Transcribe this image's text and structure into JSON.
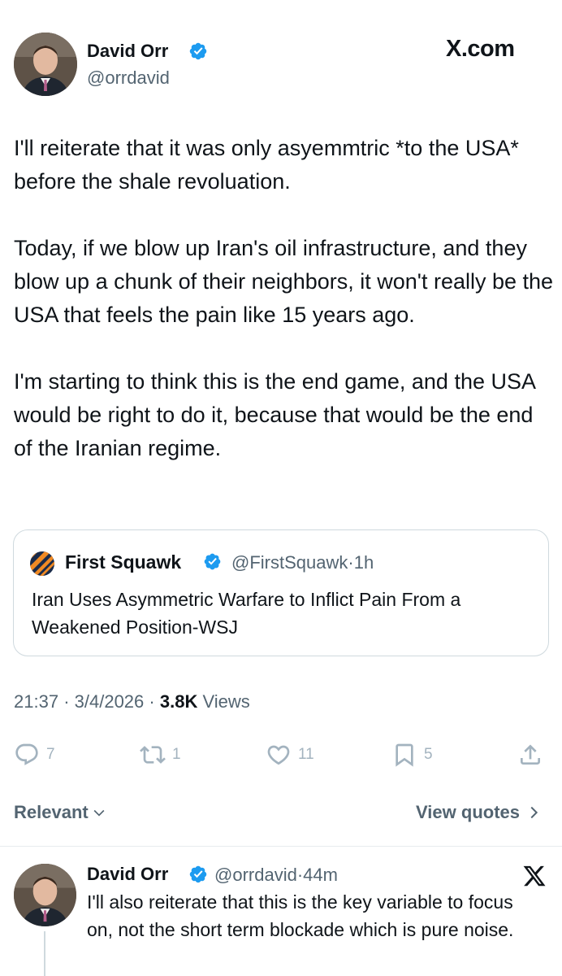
{
  "tweet": {
    "author_name": "David Orr",
    "author_handle": "@orrdavid",
    "source_watermark": "X.com",
    "paragraphs": [
      "I'll reiterate that it was only asyemmtric *to the USA* before the shale revoluation.",
      "Today, if we blow up Iran's oil infrastructure, and they blow up a chunk of their neighbors, it won't really be the USA that feels the pain like 15 years ago.",
      "I'm starting to think this is the end game, and the USA would be right to do it, because that would be the end of the Iranian regime."
    ],
    "verified_icon": "verified-badge-icon"
  },
  "quote": {
    "author_name": "First Squawk",
    "author_handle": "@FirstSquawk",
    "time": "1h",
    "text": "Iran Uses Asymmetric Warfare to Inflict Pain From a Weakened Position-WSJ",
    "logo_icon": "first-squawk-logo-icon"
  },
  "meta": {
    "time": "21:37",
    "date": "3/4/2026",
    "views_count": "3.8K",
    "views_label": "Views",
    "separator": "·"
  },
  "actions": {
    "replies": "7",
    "reposts": "1",
    "likes": "11",
    "bookmarks": "5",
    "icons": [
      "reply-icon",
      "repost-icon",
      "like-icon",
      "bookmark-icon",
      "share-icon"
    ]
  },
  "sort": {
    "relevant_label": "Relevant",
    "view_quotes_label": "View quotes"
  },
  "reply": {
    "author_name": "David Orr",
    "author_handle": "@orrdavid",
    "time": "44m",
    "text": "I'll also reiterate that this is the key variable to focus on, not the short term blockade which is pure noise."
  },
  "colors": {
    "text_primary": "#0f1419",
    "text_secondary": "#536471",
    "verified_blue": "#1d9bf0",
    "border": "#cfd9de",
    "action_icon": "#a3b3bf"
  }
}
